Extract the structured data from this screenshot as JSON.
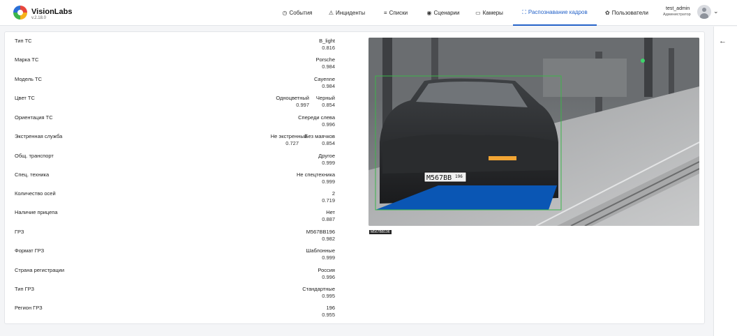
{
  "header": {
    "brand": "VisionLabs",
    "version": "v.2.18.0",
    "nav": [
      {
        "label": "События",
        "icon": "clock-icon"
      },
      {
        "label": "Инциденты",
        "icon": "warning-icon"
      },
      {
        "label": "Списки",
        "icon": "list-icon"
      },
      {
        "label": "Сценарии",
        "icon": "scenario-icon"
      },
      {
        "label": "Камеры",
        "icon": "camera-icon"
      },
      {
        "label": "Распознавание кадров",
        "icon": "frame-scan-icon",
        "active": true
      },
      {
        "label": "Пользователи",
        "icon": "users-icon"
      }
    ],
    "user": {
      "name": "test_admin",
      "role": "Администратор"
    }
  },
  "colors": {
    "accent": "#2563c9",
    "bbox": "#3cb54a",
    "plate_overlay": "#0a56b4"
  },
  "attributes": [
    {
      "label": "Тип ТС",
      "values": [
        {
          "text": "B_light",
          "score": "0.816"
        }
      ]
    },
    {
      "label": "Марка ТС",
      "values": [
        {
          "text": "Porsche",
          "score": "0.984"
        }
      ]
    },
    {
      "label": "Модель ТС",
      "values": [
        {
          "text": "Cayenne",
          "score": "0.984"
        }
      ]
    },
    {
      "label": "Цвет ТС",
      "values": [
        {
          "text": "Одноцветный",
          "score": "0.997"
        },
        {
          "text": "Черный",
          "score": "0.854"
        }
      ]
    },
    {
      "label": "Ориентация ТС",
      "values": [
        {
          "text": "Спереди слева",
          "score": "0.996"
        }
      ]
    },
    {
      "label": "Экстренная служба",
      "values": [
        {
          "text": "Не экстренный",
          "score": "0.727"
        },
        {
          "text": "Без маячков",
          "score": "0.854"
        }
      ]
    },
    {
      "label": "Общ. транспорт",
      "values": [
        {
          "text": "Другое",
          "score": "0.999"
        }
      ]
    },
    {
      "label": "Спец. техника",
      "values": [
        {
          "text": "Не спецтехника",
          "score": "0.999"
        }
      ]
    },
    {
      "label": "Количество осей",
      "values": [
        {
          "text": "2",
          "score": "0.719"
        }
      ]
    },
    {
      "label": "Наличие прицепа",
      "values": [
        {
          "text": "Нет",
          "score": "0.887"
        }
      ]
    },
    {
      "label": "ГРЗ",
      "values": [
        {
          "text": "M567BB196",
          "score": "0.982"
        }
      ]
    },
    {
      "label": "Формат ГРЗ",
      "values": [
        {
          "text": "Шаблонные",
          "score": "0.999"
        }
      ]
    },
    {
      "label": "Страна регистрации",
      "values": [
        {
          "text": "Россия",
          "score": "0.996"
        }
      ]
    },
    {
      "label": "Тип ГРЗ",
      "values": [
        {
          "text": "Стандартные",
          "score": "0.995"
        }
      ]
    },
    {
      "label": "Регион ГРЗ",
      "values": [
        {
          "text": "196",
          "score": "0.955"
        }
      ]
    }
  ],
  "image": {
    "plate_text": "M567BB",
    "plate_region": "196",
    "caption": "M567BB196"
  }
}
